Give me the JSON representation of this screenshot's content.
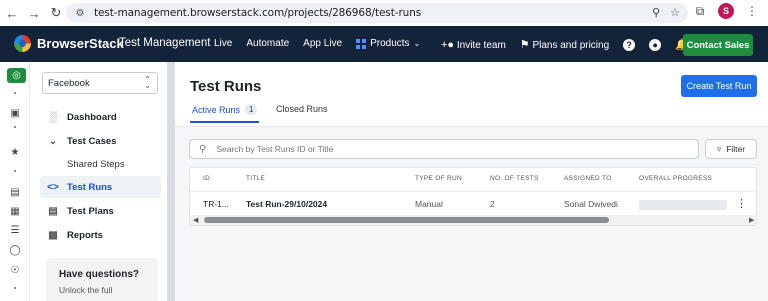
{
  "browser": {
    "url": "test-management.browserstack.com/projects/286968/test-runs",
    "profile_initial": "S"
  },
  "appbar": {
    "brand": "BrowserStack",
    "product": "Test Management",
    "nav": [
      "Live",
      "Automate",
      "App Live",
      "Products"
    ],
    "invite": "Invite team",
    "plans": "Plans and pricing",
    "contact": "Contact Sales"
  },
  "sidebar": {
    "project": "Facebook",
    "items": [
      {
        "label": "Dashboard",
        "icon": "bar-chart-icon"
      },
      {
        "label": "Test Cases",
        "icon": "chevron-down-icon"
      },
      {
        "label": "Shared Steps",
        "icon": ""
      },
      {
        "label": "Test Runs",
        "icon": "code-icon"
      },
      {
        "label": "Test Plans",
        "icon": "clipboard-icon"
      },
      {
        "label": "Reports",
        "icon": "report-icon"
      }
    ],
    "help_title": "Have questions?",
    "help_text": "Unlock the full"
  },
  "main": {
    "title": "Test Runs",
    "create_button": "Create Test Run",
    "tabs": [
      {
        "label": "Active Runs",
        "count": "1"
      },
      {
        "label": "Closed Runs"
      }
    ],
    "search_placeholder": "Search by Test Runs ID or Title",
    "filter_label": "Filter",
    "table": {
      "headers": [
        "ID",
        "TITLE",
        "TYPE OF RUN",
        "NO. OF TESTS",
        "ASSIGNED TO",
        "OVERALL PROGRESS"
      ],
      "rows": [
        {
          "id": "TR-1...",
          "title": "Test Run-29/10/2024",
          "type": "Manual",
          "tests": "2",
          "assigned": "Sonal Dwivedi"
        }
      ]
    }
  },
  "colors": {
    "appbar_bg": "#13233a",
    "accent_blue": "#1f6feb",
    "contact_green": "#1e8e3e"
  }
}
